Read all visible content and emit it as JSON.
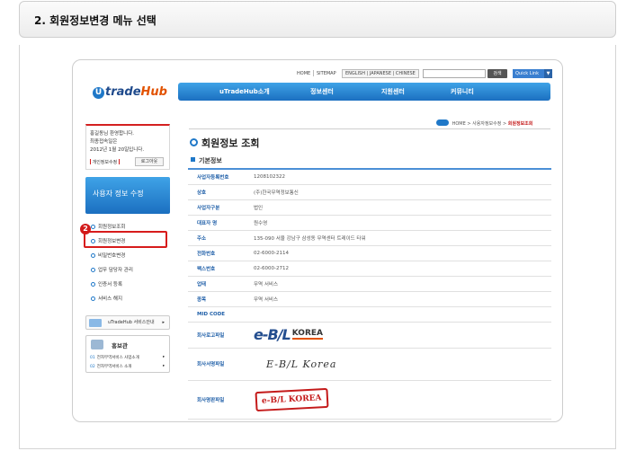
{
  "step": {
    "title": "2. 회원정보변경 메뉴 선택"
  },
  "util": {
    "links": [
      "HOME",
      "SITEMAP"
    ],
    "lang": "ENGLISH | JAPANESE | CHINESE",
    "search_input": "",
    "search_button": "검색",
    "quick_link": "Quick Link",
    "quick_arrow": "▼"
  },
  "logo": {
    "u": "U",
    "trade": "trade",
    "hub": "Hub"
  },
  "nav": [
    "uTradeHub소개",
    "정보센터",
    "지원센터",
    "커뮤니티"
  ],
  "welcome": {
    "line1": "홍길동님 환영합니다.",
    "line2": "최종접속일은",
    "line3": "2012년 1월 20일입니다.",
    "edit": "개인정보수정",
    "logout": "로그아웃"
  },
  "sidebar": {
    "heading": "사용자 정보 수정",
    "items": [
      "회원정보조회",
      "회원정보변경",
      "비밀번호변경",
      "업무 담당자 관리",
      "인증서 등록",
      "서비스 해지"
    ],
    "badge": "2"
  },
  "service_box": {
    "label": "uTradeHub 서비스안내",
    "chevron": "▸"
  },
  "promo": {
    "title": "홍보관",
    "lines": [
      {
        "num": "01",
        "text": "전자무역서비스 사업소개",
        "arrow": "▸"
      },
      {
        "num": "02",
        "text": "전자무역서비스 소개",
        "arrow": "▸"
      }
    ]
  },
  "breadcrumb": {
    "home": "HOME",
    "parent": "사용자정보수정",
    "current": "회원정보조회",
    "sep": ">"
  },
  "main": {
    "title": "회원정보 조회",
    "section": "기본정보",
    "rows": [
      {
        "label": "사업자등록번호",
        "value": "1208102322"
      },
      {
        "label": "상호",
        "value": "(주)한국무역정보통신"
      },
      {
        "label": "사업자구분",
        "value": "법인"
      },
      {
        "label": "대표자 명",
        "value": "원수영"
      },
      {
        "label": "주소",
        "value": "135-090 서울 강남구 삼성동 무역센터 트레이드 타워"
      },
      {
        "label": "전화번호",
        "value": "02-6000-2114"
      },
      {
        "label": "팩스번호",
        "value": "02-6000-2712"
      },
      {
        "label": "업태",
        "value": "무역 서비스"
      },
      {
        "label": "종목",
        "value": "무역 서비스"
      },
      {
        "label": "MID CODE",
        "value": ""
      }
    ],
    "logo_label": "회사로고파일",
    "sign_label": "회사서명파일",
    "stamp_label": "회사명판파일",
    "logo_text": "e-B/L",
    "logo_korea": "KOREA",
    "sign_text": "E-B/L Korea",
    "stamp_text": "e-B/L KOREA"
  },
  "colors": {
    "accent": "#1f78c8",
    "highlight": "#d71b1b",
    "nav_top": "#3fa3e7",
    "nav_bottom": "#1b6fc0"
  }
}
